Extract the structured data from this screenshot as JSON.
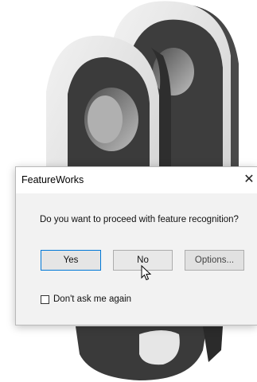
{
  "dialog": {
    "title": "FeatureWorks",
    "close_glyph": "✕",
    "message": "Do you want to proceed with feature recognition?",
    "buttons": {
      "yes": "Yes",
      "no": "No",
      "options": "Options..."
    },
    "checkbox": {
      "label": "Don't ask me again",
      "checked": false
    }
  },
  "cursor": {
    "icon": "arrow-pointer-icon"
  },
  "colors": {
    "default_button_border": "#0078d7",
    "part_light": "#e3e3e3",
    "part_dark": "#3a3a3a"
  }
}
